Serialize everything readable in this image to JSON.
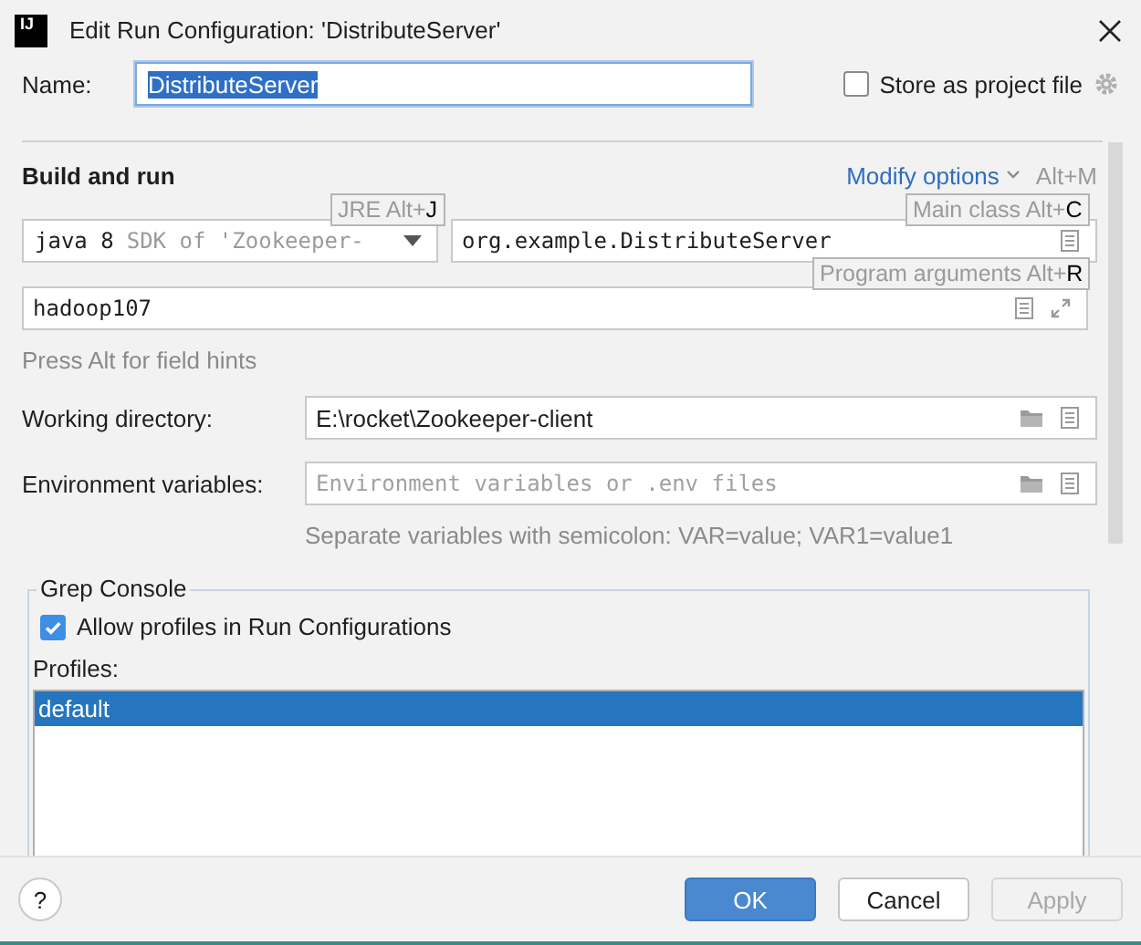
{
  "window": {
    "logo": "IJ",
    "title": "Edit Run Configuration: 'DistributeServer'"
  },
  "name": {
    "label": "Name:",
    "value": "DistributeServer",
    "text_selected": true
  },
  "store_as_project_file": {
    "label": "Store as project file",
    "checked": false
  },
  "section": {
    "title": "Build and run",
    "modify_options": "Modify options",
    "modify_shortcut": "Alt+M"
  },
  "jre": {
    "value": "java 8",
    "hint": "SDK of 'Zookeeper-"
  },
  "main_class": {
    "value": "org.example.DistributeServer"
  },
  "program_arguments": {
    "value": "hadoop107"
  },
  "field_hints": [
    {
      "kind": "jre",
      "text": "JRE Alt+**J**"
    },
    {
      "kind": "main_class",
      "text": "Main class Alt+**C**"
    },
    {
      "kind": "program_arguments",
      "text": "Program arguments Alt+**R**"
    }
  ],
  "hint_text": "Press Alt for field hints",
  "working_directory": {
    "label": "Working directory:",
    "value": "E:\\rocket\\Zookeeper-client"
  },
  "environment_variables": {
    "label": "Environment variables:",
    "placeholder": "Environment variables or .env files",
    "note": "Separate variables with semicolon: VAR=value; VAR1=value1"
  },
  "grep_console": {
    "title": "Grep Console",
    "allow_profiles": {
      "label": "Allow profiles in Run Configurations",
      "checked": true
    },
    "profiles_label": "Profiles:",
    "profiles": [
      {
        "name": "default",
        "selected": true
      }
    ]
  },
  "help": "?",
  "buttons": [
    {
      "label": "OK",
      "kind": "primary",
      "disabled": false
    },
    {
      "label": "Cancel",
      "kind": "normal",
      "disabled": false
    },
    {
      "label": "Apply",
      "kind": "normal",
      "disabled": true
    }
  ]
}
